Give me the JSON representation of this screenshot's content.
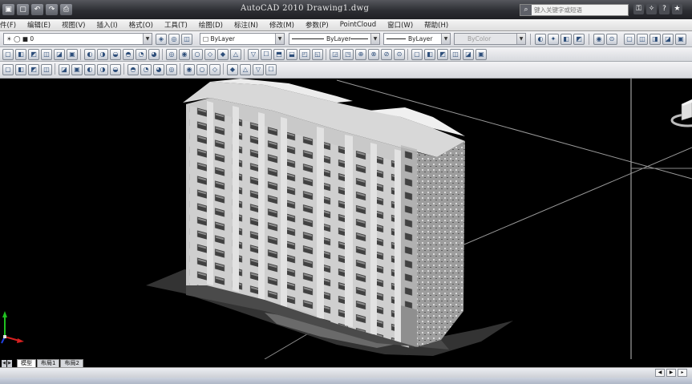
{
  "titlebar": {
    "quick_access": [
      "▣",
      "▢",
      "↶",
      "↷",
      "⎙"
    ],
    "title": "AutoCAD 2010   Drawing1.dwg",
    "search_placeholder": "键入关键字或短语",
    "tools": [
      "⚿",
      "✧",
      "?",
      "★"
    ]
  },
  "menubar": {
    "items": [
      "件(F)",
      "编辑(E)",
      "视图(V)",
      "插入(I)",
      "格式(O)",
      "工具(T)",
      "绘图(D)",
      "标注(N)",
      "修改(M)",
      "参数(P)",
      "PointCloud",
      "窗口(W)",
      "帮助(H)"
    ]
  },
  "toolbar1": {
    "layer_value": "☀ ◯ ■ 0",
    "color_value": "□ ByLayer",
    "linetype_value": "ByLayer",
    "lineweight_value": "ByLayer",
    "plotstyle_value": "ByColor"
  },
  "tabs": {
    "items": [
      "模型",
      "布局1",
      "布局2"
    ],
    "active": "模型"
  },
  "colors": {
    "titlebar": "#2d2e33",
    "viewport_background": "#000000",
    "pointcloud": "#e6e6e6",
    "ucs_x": "#d62020",
    "ucs_y": "#20c020",
    "ucs_z": "#2040e0"
  },
  "viewport": {
    "content": "point-cloud-building",
    "ucs_icon": "ucs-icon",
    "viewcube": "viewcube-icon"
  },
  "icons": {
    "toolbar_row2": [
      "new-icon",
      "open-icon",
      "save-icon",
      "print-icon",
      "undo-icon",
      "redo-icon",
      "pan-icon",
      "zoom-icon",
      "orbit-icon",
      "render-icon",
      "visual-style-icon",
      "layer-icon",
      "line-icon",
      "circle-icon",
      "arc-icon",
      "rectangle-icon",
      "polygon-icon",
      "hatch-icon",
      "region-icon",
      "text-icon",
      "insert-icon",
      "block-icon",
      "table-icon",
      "move-icon",
      "copy-icon",
      "rotate-icon",
      "scale-icon",
      "mirror-icon",
      "offset-icon",
      "array-icon",
      "trim-icon",
      "extend-icon",
      "fillet-icon",
      "chamfer-icon",
      "explode-icon",
      "erase-icon"
    ],
    "toolbar_row3": [
      "box-icon",
      "cylinder-icon",
      "sphere-icon",
      "cone-icon",
      "wedge-icon",
      "torus-icon",
      "extrude-icon",
      "revolve-icon",
      "sweep-icon",
      "loft-icon",
      "union-icon",
      "subtract-icon",
      "intersect-icon",
      "slice-icon",
      "move3d-icon",
      "rotate3d-icon",
      "align-icon",
      "mirror3d-icon",
      "array3d-icon",
      "section-icon"
    ]
  }
}
